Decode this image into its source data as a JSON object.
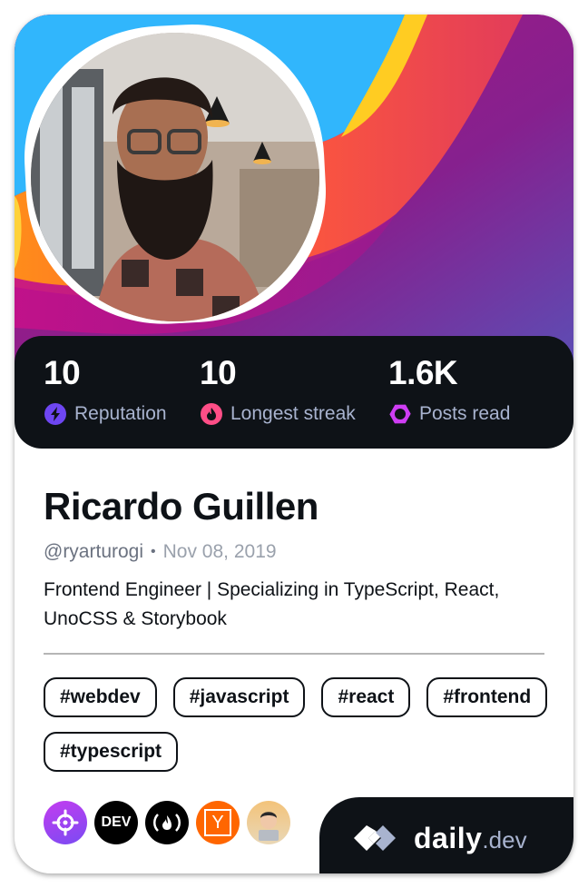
{
  "profile": {
    "name": "Ricardo Guillen",
    "username": "@ryarturogi",
    "separator": "•",
    "joined": "Nov 08, 2019",
    "bio": "Frontend Engineer | Specializing in TypeScript, React, UnoCSS & Storybook"
  },
  "stats": [
    {
      "value": "10",
      "label": "Reputation",
      "icon": "lightning-icon",
      "color": "#6e46f2"
    },
    {
      "value": "10",
      "label": "Longest streak",
      "icon": "flame-icon",
      "color": "#ff4e87"
    },
    {
      "value": "1.6K",
      "label": "Posts read",
      "icon": "eye-icon",
      "color": "#ce3df3"
    }
  ],
  "tags": [
    "#webdev",
    "#javascript",
    "#react",
    "#frontend",
    "#typescript"
  ],
  "sources": [
    {
      "name": "crosshair-source-icon",
      "text": "",
      "bg": "#a13ef5"
    },
    {
      "name": "dev-to-source-icon",
      "text": "DEV",
      "bg": "#000000"
    },
    {
      "name": "freecodecamp-source-icon",
      "text": "(🔥)",
      "bg": "#000000"
    },
    {
      "name": "hacker-news-source-icon",
      "text": "Y",
      "bg": "#ff6600"
    },
    {
      "name": "avatar-source-icon",
      "text": "",
      "bg": "#f3c37a"
    }
  ],
  "brand": {
    "primary": "daily",
    "secondary": ".dev"
  },
  "colors": {
    "dark": "#0e1217",
    "muted": "#a8b3cf"
  }
}
